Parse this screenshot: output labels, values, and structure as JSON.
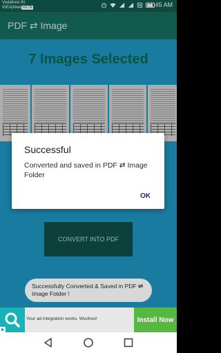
{
  "status_bar": {
    "carrier_line1": "Vodafone IN",
    "carrier_line2": "IDEA|Idea",
    "volte_badge": "VoLTE",
    "time": "11:45 AM",
    "icons": [
      "alarm-icon",
      "wifi-icon",
      "signal-icon",
      "signal-icon",
      "nfc-icon",
      "battery-icon"
    ]
  },
  "app_bar": {
    "title": "PDF ⇄ Image"
  },
  "main": {
    "selected_text": "7 Images Selected",
    "convert_label": "CONVERT INTO PDF",
    "thumbnail_count": 5
  },
  "dialog": {
    "title": "Successful",
    "message": "Converted and saved in PDF ⇄ Image Folder",
    "ok_label": "OK"
  },
  "toast": {
    "message": "Successfully Converted & Saved in PDF ⇄ Image Folder !"
  },
  "ad": {
    "text": "Your ad integration works. Woohoo!",
    "install_label": "Install Now",
    "icon": "search-icon"
  },
  "nav_bar": {
    "icons": [
      "back-icon",
      "home-icon",
      "recents-icon"
    ]
  },
  "colors": {
    "status_bar": "#0f5a4e",
    "app_bar": "#176e60",
    "content_bg": "#1f97c4",
    "accent_text": "#0c6751",
    "convert_button": "#0f4f48",
    "dialog_ok": "#2b1c86",
    "install_button": "#56b741"
  }
}
